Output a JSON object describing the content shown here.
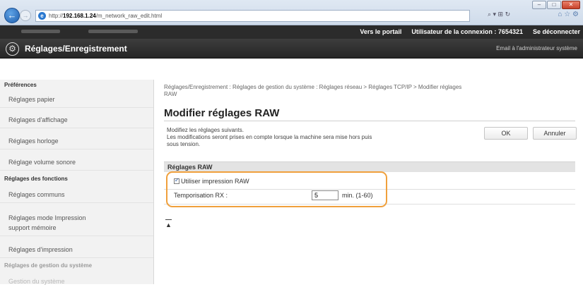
{
  "browser": {
    "url_prefix": "http://",
    "url_host": "192.168.1.24",
    "url_path": "/m_network_raw_edit.html",
    "address_tools": "⌕ ▾ ⊞ ↻",
    "tab_tools": "⌂ ☆ ⚙",
    "win_min": "–",
    "win_max": "□",
    "win_close": "✕"
  },
  "header": {
    "portal_link": "Vers le portail",
    "login_user_label": "Utilisateur de la connexion :",
    "login_user_value": "7654321",
    "logout_link": "Se déconnecter",
    "page_brand": "Réglages/Enregistrement",
    "email_admin": "Email à l'administrateur système"
  },
  "sidebar": {
    "sections": [
      {
        "label": "Préférences"
      },
      {
        "label": "Réglages des fonctions"
      },
      {
        "label": "Réglages de gestion du système"
      }
    ],
    "items": [
      {
        "label": "Réglages papier"
      },
      {
        "label": "Réglages d'affichage"
      },
      {
        "label": "Réglages horloge"
      },
      {
        "label": "Réglage volume sonore"
      },
      {
        "label": "Réglages communs"
      },
      {
        "label": "Réglages mode Impression"
      },
      {
        "label": "support mémoire"
      },
      {
        "label": "Réglages d'impression"
      },
      {
        "label": "Gestion du système"
      }
    ]
  },
  "main": {
    "breadcrumb_line1": "Réglages/Enregistrement : Réglages de gestion du système : Réglages réseau > Réglages TCP/IP > Modifier réglages",
    "breadcrumb_line2": "RAW",
    "title": "Modifier réglages RAW",
    "intro_line1": "Modifiez les réglages suivants.",
    "intro_line2": "Les modifications seront prises en compte lorsque la machine sera mise hors puis",
    "intro_line3": "sous tension.",
    "ok_label": "OK",
    "cancel_label": "Annuler",
    "section_title": "Réglages RAW",
    "use_raw_label": "Utiliser impression RAW",
    "use_raw_checked": true,
    "timeout_label": "Temporisation RX :",
    "timeout_value": "5",
    "timeout_unit": "min. (1-60)",
    "highlight_color": "#f0a03c"
  }
}
